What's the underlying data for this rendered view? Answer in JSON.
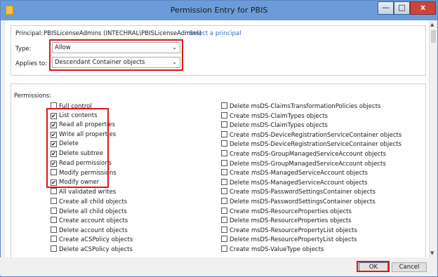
{
  "window": {
    "title": "Permission Entry for PBIS",
    "minimize_label": "—",
    "maximize_label": "□",
    "close_label": "x"
  },
  "principal": {
    "label": "Principal:",
    "value": "PBISLicenseAdmins (INTECHRAL\\PBISLicenseAdmins)",
    "link": "Select a principal"
  },
  "type": {
    "label": "Type:",
    "value": "Allow"
  },
  "applies_to": {
    "label": "Applies to:",
    "value": "Descendant Container objects"
  },
  "permissions": {
    "heading": "Permissions:",
    "left": [
      {
        "label": "Full control",
        "checked": false
      },
      {
        "label": "List contents",
        "checked": true
      },
      {
        "label": "Read all properties",
        "checked": true
      },
      {
        "label": "Write all properties",
        "checked": true
      },
      {
        "label": "Delete",
        "checked": true
      },
      {
        "label": "Delete subtree",
        "checked": true
      },
      {
        "label": "Read permissions",
        "checked": true
      },
      {
        "label": "Modify permissions",
        "checked": false
      },
      {
        "label": "Modify owner",
        "checked": true
      },
      {
        "label": "All validated writes",
        "checked": false
      },
      {
        "label": "Create all child objects",
        "checked": false
      },
      {
        "label": "Delete all child objects",
        "checked": false
      },
      {
        "label": "Create account objects",
        "checked": false
      },
      {
        "label": "Delete account objects",
        "checked": false
      },
      {
        "label": "Create aCSPolicy objects",
        "checked": false
      },
      {
        "label": "Delete aCSPolicy objects",
        "checked": false
      }
    ],
    "right": [
      {
        "label": "Delete msDS-ClaimsTransformationPolicies objects",
        "checked": false
      },
      {
        "label": "Create msDS-ClaimTypes objects",
        "checked": false
      },
      {
        "label": "Delete msDS-ClaimTypes objects",
        "checked": false
      },
      {
        "label": "Create msDS-DeviceRegistrationServiceContainer objects",
        "checked": false
      },
      {
        "label": "Delete msDS-DeviceRegistrationServiceContainer objects",
        "checked": false
      },
      {
        "label": "Create msDS-GroupManagedServiceAccount objects",
        "checked": false
      },
      {
        "label": "Delete msDS-GroupManagedServiceAccount objects",
        "checked": false
      },
      {
        "label": "Create msDS-ManagedServiceAccount objects",
        "checked": false
      },
      {
        "label": "Delete msDS-ManagedServiceAccount objects",
        "checked": false
      },
      {
        "label": "Create msDS-PasswordSettingsContainer objects",
        "checked": false
      },
      {
        "label": "Delete msDS-PasswordSettingsContainer objects",
        "checked": false
      },
      {
        "label": "Create msDS-ResourceProperties objects",
        "checked": false
      },
      {
        "label": "Delete msDS-ResourceProperties objects",
        "checked": false
      },
      {
        "label": "Create msDS-ResourcePropertyList objects",
        "checked": false
      },
      {
        "label": "Delete msDS-ResourcePropertyList objects",
        "checked": false
      },
      {
        "label": "Create msDS-ValueType objects",
        "checked": false
      }
    ]
  },
  "buttons": {
    "ok": "OK",
    "cancel": "Cancel"
  },
  "colors": {
    "titlebar": "#6b9bd8",
    "highlight": "#e01616",
    "link": "#2b6cc4"
  }
}
